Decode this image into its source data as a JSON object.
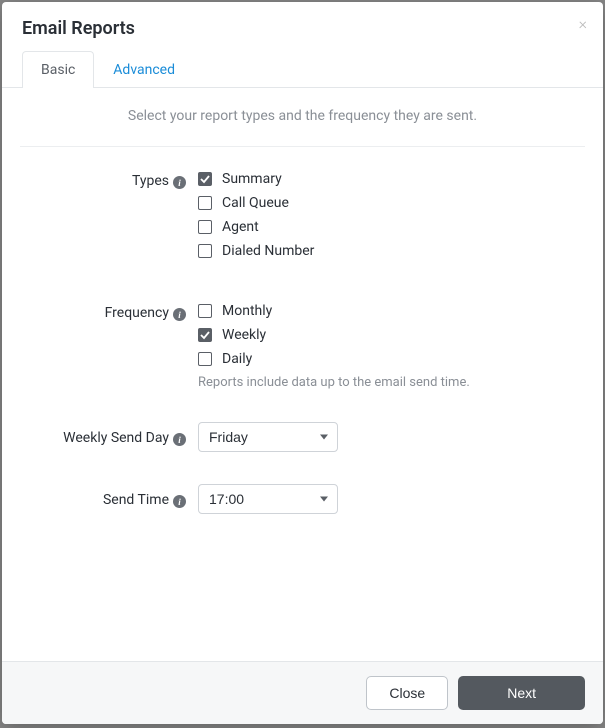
{
  "modal": {
    "title": "Email Reports",
    "close_x": "×"
  },
  "tabs": {
    "basic": "Basic",
    "advanced": "Advanced"
  },
  "intro": "Select your report types and the frequency they are sent.",
  "labels": {
    "types": "Types",
    "frequency": "Frequency",
    "weekly_send_day": "Weekly Send Day",
    "send_time": "Send Time"
  },
  "types": {
    "summary": {
      "label": "Summary",
      "checked": true
    },
    "call_queue": {
      "label": "Call Queue",
      "checked": false
    },
    "agent": {
      "label": "Agent",
      "checked": false
    },
    "dialed_number": {
      "label": "Dialed Number",
      "checked": false
    }
  },
  "frequency": {
    "monthly": {
      "label": "Monthly",
      "checked": false
    },
    "weekly": {
      "label": "Weekly",
      "checked": true
    },
    "daily": {
      "label": "Daily",
      "checked": false
    },
    "help": "Reports include data up to the email send time."
  },
  "weekly_send_day": {
    "selected": "Friday"
  },
  "send_time": {
    "selected": "17:00"
  },
  "buttons": {
    "close": "Close",
    "next": "Next"
  },
  "info_icon_glyph": "i"
}
